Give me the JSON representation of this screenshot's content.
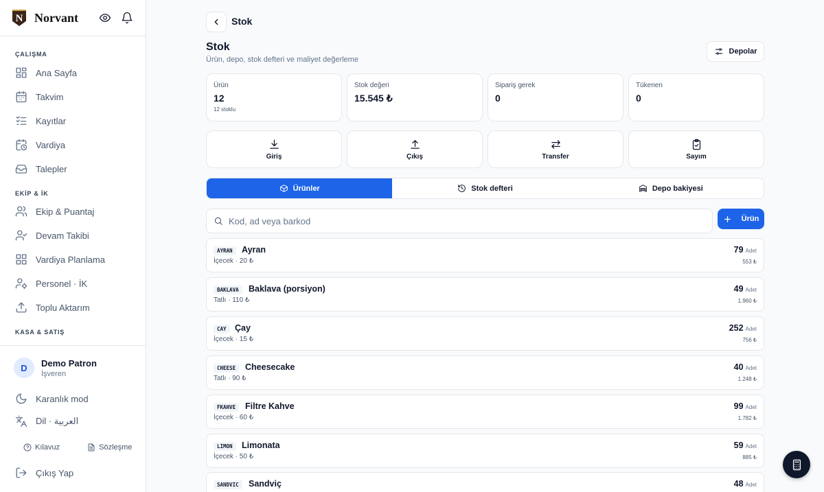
{
  "brand": {
    "name": "Norvant",
    "logo_letter": "N"
  },
  "sidebar": {
    "sections": [
      {
        "title": "ÇALIŞMA",
        "items": [
          {
            "label": "Ana Sayfa",
            "icon": "grid-icon"
          },
          {
            "label": "Takvim",
            "icon": "calendar-icon"
          },
          {
            "label": "Kayıtlar",
            "icon": "checklist-icon"
          },
          {
            "label": "Vardiya",
            "icon": "calendar-clock-icon"
          },
          {
            "label": "Talepler",
            "icon": "inbox-icon"
          }
        ]
      },
      {
        "title": "EKİP & İK",
        "items": [
          {
            "label": "Ekip & Puantaj",
            "icon": "users-icon"
          },
          {
            "label": "Devam Takibi",
            "icon": "user-check-icon"
          },
          {
            "label": "Vardiya Planlama",
            "icon": "grid-icon"
          },
          {
            "label": "Personel · İK",
            "icon": "user-cog-icon"
          },
          {
            "label": "Toplu Aktarım",
            "icon": "upload-icon"
          }
        ]
      },
      {
        "title": "KASA & SATIŞ",
        "items": []
      }
    ],
    "user": {
      "initial": "D",
      "name": "Demo Patron",
      "role": "İşveren"
    },
    "dark_mode": "Karanlık mod",
    "language": "Dil · العربية",
    "guide": "Kılavuz",
    "agreement": "Sözleşme",
    "logout": "Çıkış Yap"
  },
  "header": {
    "crumb": "Stok",
    "title": "Stok",
    "subtitle": "Ürün, depo, stok defteri ve maliyet değerleme",
    "warehouses_button": "Depolar"
  },
  "stats": [
    {
      "label": "Ürün",
      "value": "12",
      "sub": "12 stoklu"
    },
    {
      "label": "Stok değeri",
      "value": "15.545 ₺",
      "sub": ""
    },
    {
      "label": "Sipariş gerek",
      "value": "0",
      "sub": ""
    },
    {
      "label": "Tükenen",
      "value": "0",
      "sub": ""
    }
  ],
  "actions": [
    {
      "label": "Giriş",
      "icon": "download-icon"
    },
    {
      "label": "Çıkış",
      "icon": "upload-icon"
    },
    {
      "label": "Transfer",
      "icon": "transfer-icon"
    },
    {
      "label": "Sayım",
      "icon": "clipboard-check-icon"
    }
  ],
  "tabs": [
    {
      "label": "Ürünler",
      "icon": "box-icon",
      "active": true
    },
    {
      "label": "Stok defteri",
      "icon": "history-icon",
      "active": false
    },
    {
      "label": "Depo bakiyesi",
      "icon": "warehouse-icon",
      "active": false
    }
  ],
  "search": {
    "placeholder": "Kod, ad veya barkod",
    "value": ""
  },
  "add_button": "Ürün",
  "products": [
    {
      "code": "AYRAN",
      "name": "Ayran",
      "meta": "İçecek · 20 ₺",
      "qty": "79",
      "unit": "Adet",
      "value": "553 ₺"
    },
    {
      "code": "BAKLAVA",
      "name": "Baklava (porsiyon)",
      "meta": "Tatlı · 110 ₺",
      "qty": "49",
      "unit": "Adet",
      "value": "1.960 ₺"
    },
    {
      "code": "CAY",
      "name": "Çay",
      "meta": "İçecek · 15 ₺",
      "qty": "252",
      "unit": "Adet",
      "value": "756 ₺"
    },
    {
      "code": "CHEESE",
      "name": "Cheesecake",
      "meta": "Tatlı · 90 ₺",
      "qty": "40",
      "unit": "Adet",
      "value": "1.248 ₺"
    },
    {
      "code": "FKAHVE",
      "name": "Filtre Kahve",
      "meta": "İçecek · 60 ₺",
      "qty": "99",
      "unit": "Adet",
      "value": "1.782 ₺"
    },
    {
      "code": "LIMON",
      "name": "Limonata",
      "meta": "İçecek · 50 ₺",
      "qty": "59",
      "unit": "Adet",
      "value": "885 ₺"
    },
    {
      "code": "SANDVIC",
      "name": "Sandviç",
      "meta": "",
      "qty": "48",
      "unit": "Adet",
      "value": ""
    }
  ],
  "colors": {
    "accent": "#1d64e8",
    "fab": "#0f172a"
  }
}
